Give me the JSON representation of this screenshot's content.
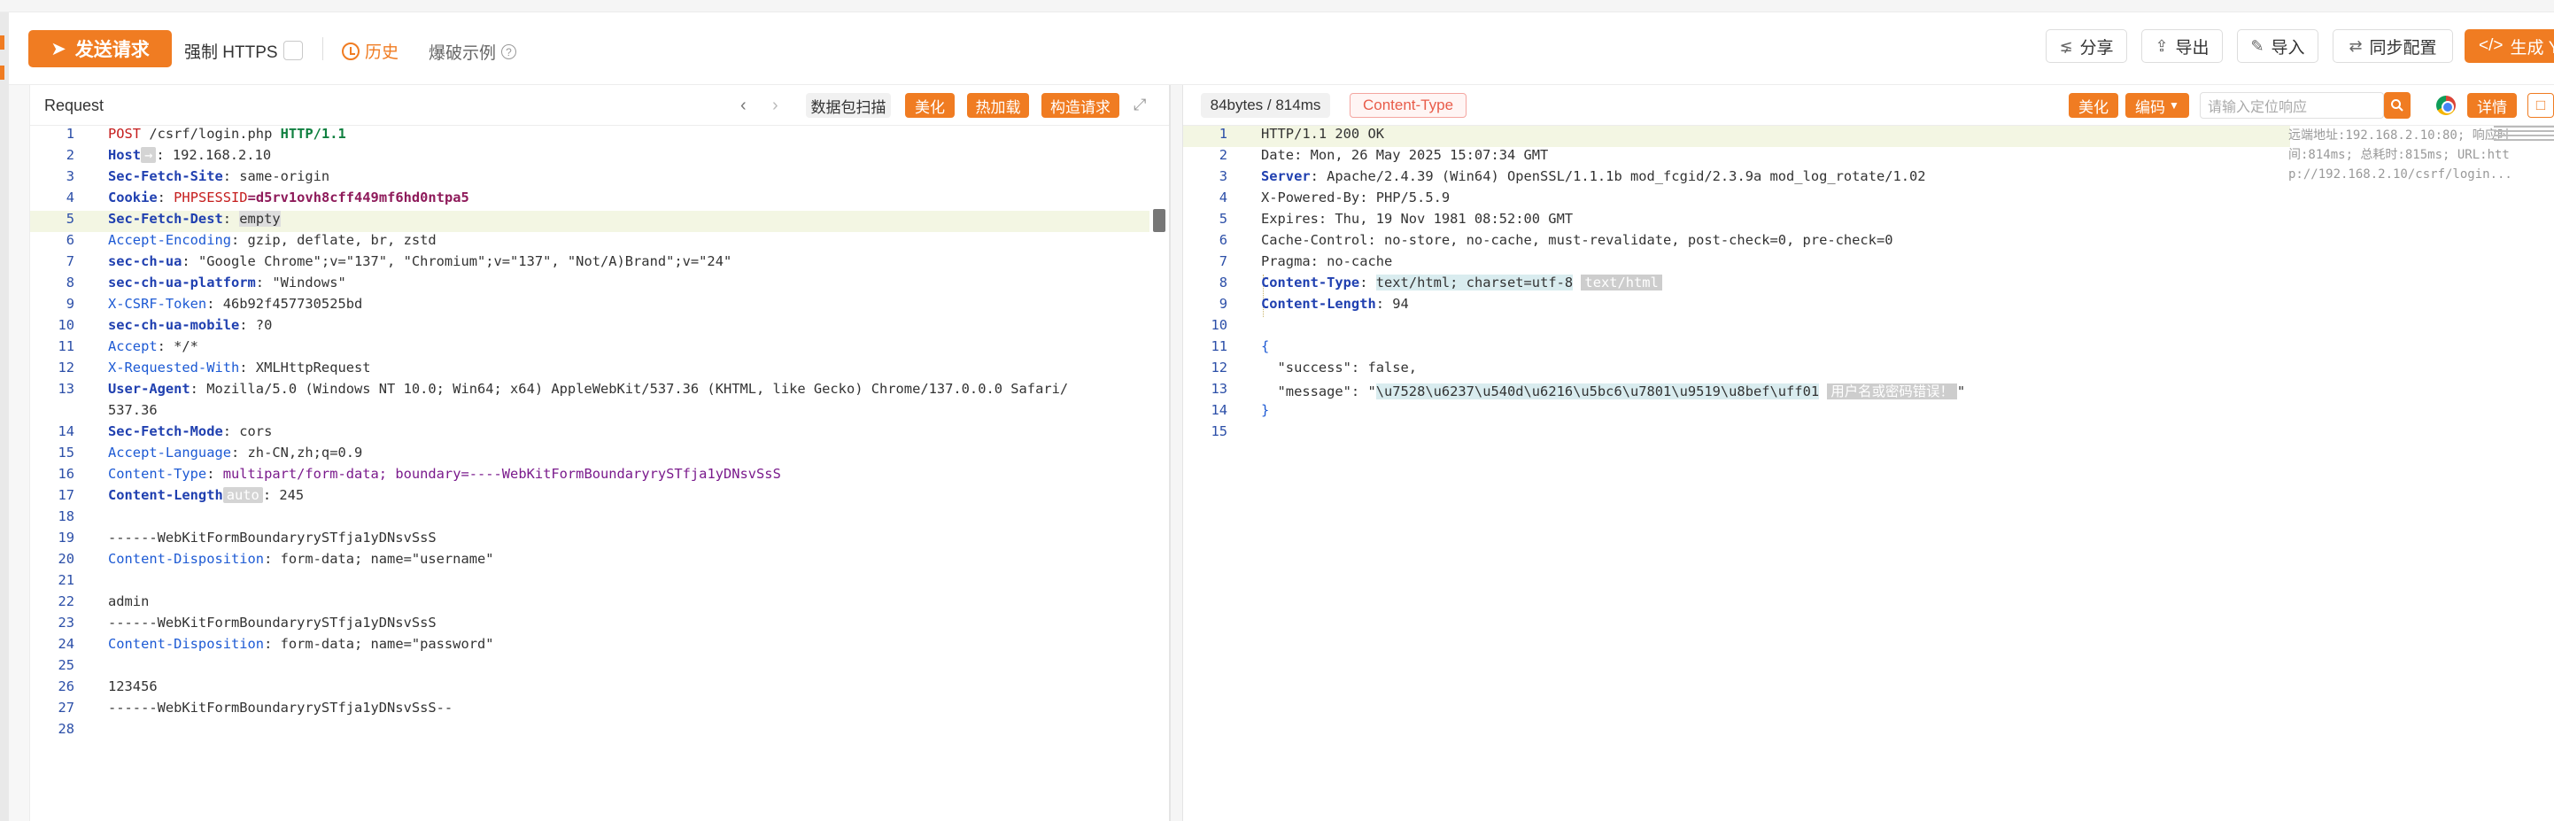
{
  "toolbar": {
    "send_label": "发送请求",
    "force_https_label": "强制 HTTPS",
    "history_label": "历史",
    "blast_label": "爆破示例",
    "share_label": "分享",
    "export_label": "导出",
    "import_label": "导入",
    "sync_label": "同步配置",
    "generate_label": "生成 Yar"
  },
  "request": {
    "title": "Request",
    "scan_label": "数据包扫描",
    "beautify_label": "美化",
    "hotload_label": "热加载",
    "construct_label": "构造请求",
    "lines": [
      {
        "n": "1",
        "t": [
          [
            "POST",
            "red"
          ],
          [
            " /csrf/login.php ",
            ""
          ],
          [
            "HTTP/1.1",
            "green"
          ]
        ]
      },
      {
        "n": "2",
        "t": [
          [
            "Host",
            "navy"
          ],
          [
            "chip:→",
            ""
          ],
          [
            ": 192.168.2.10",
            ""
          ]
        ]
      },
      {
        "n": "3",
        "t": [
          [
            "Sec-Fetch-Site",
            "navy"
          ],
          [
            ": same-origin",
            ""
          ]
        ]
      },
      {
        "n": "4",
        "t": [
          [
            "Cookie",
            "navy"
          ],
          [
            ": ",
            ""
          ],
          [
            "PHPSESSID",
            "red"
          ],
          [
            "=d5rv1ovh8cff449mf6hd0ntpa5",
            "plum"
          ]
        ]
      },
      {
        "n": "5",
        "t": [
          [
            "Sec-Fetch-Dest",
            "navy"
          ],
          [
            ": ",
            ""
          ],
          [
            "sel:empty",
            ""
          ]
        ]
      },
      {
        "n": "6",
        "t": [
          [
            "Accept-Encoding",
            "blue"
          ],
          [
            ": gzip, deflate, br, zstd",
            ""
          ]
        ]
      },
      {
        "n": "7",
        "t": [
          [
            "sec-ch-ua",
            "navy"
          ],
          [
            ": \"Google Chrome\";v=\"137\", \"Chromium\";v=\"137\", \"Not/A)Brand\";v=\"24\"",
            ""
          ]
        ]
      },
      {
        "n": "8",
        "t": [
          [
            "sec-ch-ua-platform",
            "navy"
          ],
          [
            ": \"Windows\"",
            ""
          ]
        ]
      },
      {
        "n": "9",
        "t": [
          [
            "X-CSRF-Token",
            "blue"
          ],
          [
            ": 46b92f457730525bd",
            ""
          ]
        ]
      },
      {
        "n": "10",
        "t": [
          [
            "sec-ch-ua-mobile",
            "navy"
          ],
          [
            ": ?0",
            ""
          ]
        ]
      },
      {
        "n": "11",
        "t": [
          [
            "Accept",
            "blue"
          ],
          [
            ": */*",
            ""
          ]
        ]
      },
      {
        "n": "12",
        "t": [
          [
            "X-Requested-With",
            "blue"
          ],
          [
            ": XMLHttpRequest",
            ""
          ]
        ]
      },
      {
        "n": "13",
        "t": [
          [
            "User-Agent",
            "navy"
          ],
          [
            ": Mozilla/5.0 (Windows NT 10.0; Win64; x64) AppleWebKit/537.36 (KHTML, like Gecko) Chrome/137.0.0.0 Safari/",
            ""
          ]
        ]
      },
      {
        "n": "",
        "t": [
          [
            "537.36",
            ""
          ]
        ]
      },
      {
        "n": "14",
        "t": [
          [
            "Sec-Fetch-Mode",
            "navy"
          ],
          [
            ": cors",
            ""
          ]
        ]
      },
      {
        "n": "15",
        "t": [
          [
            "Accept-Language",
            "blue"
          ],
          [
            ": zh-CN,zh;q=0.9",
            ""
          ]
        ]
      },
      {
        "n": "16",
        "t": [
          [
            "Content-Type",
            "blue"
          ],
          [
            ": ",
            ""
          ],
          [
            "multipart/form-data; boundary=----WebKitFormBoundaryrySTfja1yDNsvSsS",
            "purple"
          ]
        ]
      },
      {
        "n": "17",
        "t": [
          [
            "Content-Length",
            "navy"
          ],
          [
            "chip:auto",
            ""
          ],
          [
            ": 245",
            ""
          ]
        ]
      },
      {
        "n": "18",
        "t": [
          [
            "",
            ""
          ]
        ]
      },
      {
        "n": "19",
        "t": [
          [
            "------WebKitFormBoundaryrySTfja1yDNsvSsS",
            ""
          ]
        ]
      },
      {
        "n": "20",
        "t": [
          [
            "Content-Disposition",
            "blue"
          ],
          [
            ": form-data; name=\"username\"",
            ""
          ]
        ]
      },
      {
        "n": "21",
        "t": [
          [
            "",
            ""
          ]
        ]
      },
      {
        "n": "22",
        "t": [
          [
            "admin",
            ""
          ]
        ]
      },
      {
        "n": "23",
        "t": [
          [
            "------WebKitFormBoundaryrySTfja1yDNsvSsS",
            ""
          ]
        ]
      },
      {
        "n": "24",
        "t": [
          [
            "Content-Disposition",
            "blue"
          ],
          [
            ": form-data; name=\"password\"",
            ""
          ]
        ]
      },
      {
        "n": "25",
        "t": [
          [
            "",
            ""
          ]
        ]
      },
      {
        "n": "26",
        "t": [
          [
            "123456",
            ""
          ]
        ]
      },
      {
        "n": "27",
        "t": [
          [
            "------WebKitFormBoundaryrySTfja1yDNsvSsS--",
            ""
          ]
        ]
      },
      {
        "n": "28",
        "t": [
          [
            "",
            ""
          ]
        ]
      }
    ]
  },
  "response": {
    "size_label": "84bytes / 814ms",
    "content_type_label": "Content-Type",
    "beautify_label": "美化",
    "encoding_label": "编码",
    "search_placeholder": "请输入定位响应",
    "detail_label": "详情",
    "info_line1": "远端地址:192.168.2.10:80; 响应时",
    "info_line2": "间:814ms; 总耗时:815ms; URL:htt",
    "info_line3": "p://192.168.2.10/csrf/login...",
    "lines": [
      {
        "n": "1",
        "t": [
          [
            "HTTP/1.1 200 OK",
            ""
          ]
        ]
      },
      {
        "n": "2",
        "t": [
          [
            "Date: Mon, 26 May 2025 15:07:34 GMT",
            ""
          ]
        ]
      },
      {
        "n": "3",
        "t": [
          [
            "Server",
            "navy"
          ],
          [
            ": Apache/2.4.39 (Win64) OpenSSL/1.1.1b mod_fcgid/2.3.9a mod_log_rotate/1.02",
            ""
          ]
        ]
      },
      {
        "n": "4",
        "t": [
          [
            "X-Powered-By: PHP/5.5.9",
            ""
          ]
        ]
      },
      {
        "n": "5",
        "t": [
          [
            "Expires: Thu, 19 Nov 1981 08:52:00 GMT",
            ""
          ]
        ]
      },
      {
        "n": "6",
        "t": [
          [
            "Cache-Control: no-store, no-cache, must-revalidate, post-check=0, pre-check=0",
            ""
          ]
        ]
      },
      {
        "n": "7",
        "t": [
          [
            "Pragma: no-cache",
            ""
          ]
        ]
      },
      {
        "n": "8",
        "t": [
          [
            "Content-Type",
            "navy"
          ],
          [
            ": ",
            ""
          ],
          [
            "sel2:text/html; charset=utf-8",
            ""
          ],
          [
            " ",
            ""
          ],
          [
            "chip2:text/html",
            ""
          ]
        ]
      },
      {
        "n": "9",
        "t": [
          [
            "Content-Length",
            "navy"
          ],
          [
            ": 94",
            ""
          ]
        ]
      },
      {
        "n": "10",
        "t": [
          [
            "",
            ""
          ]
        ]
      },
      {
        "n": "11",
        "t": [
          [
            "{",
            "blue"
          ]
        ]
      },
      {
        "n": "12",
        "t": [
          [
            "  \"success\": false,",
            ""
          ]
        ]
      },
      {
        "n": "13",
        "t": [
          [
            "  \"message\": \"",
            ""
          ],
          [
            "sel2:\\u7528\\u6237\\u540d\\u6216\\u5bc6\\u7801\\u9519\\u8bef\\uff01",
            ""
          ],
          [
            " ",
            ""
          ],
          [
            "chip2:用户名或密码错误！",
            ""
          ],
          [
            "\"",
            ""
          ]
        ]
      },
      {
        "n": "14",
        "t": [
          [
            "}",
            "blue"
          ]
        ]
      },
      {
        "n": "15",
        "t": [
          [
            "",
            ""
          ]
        ]
      }
    ]
  }
}
